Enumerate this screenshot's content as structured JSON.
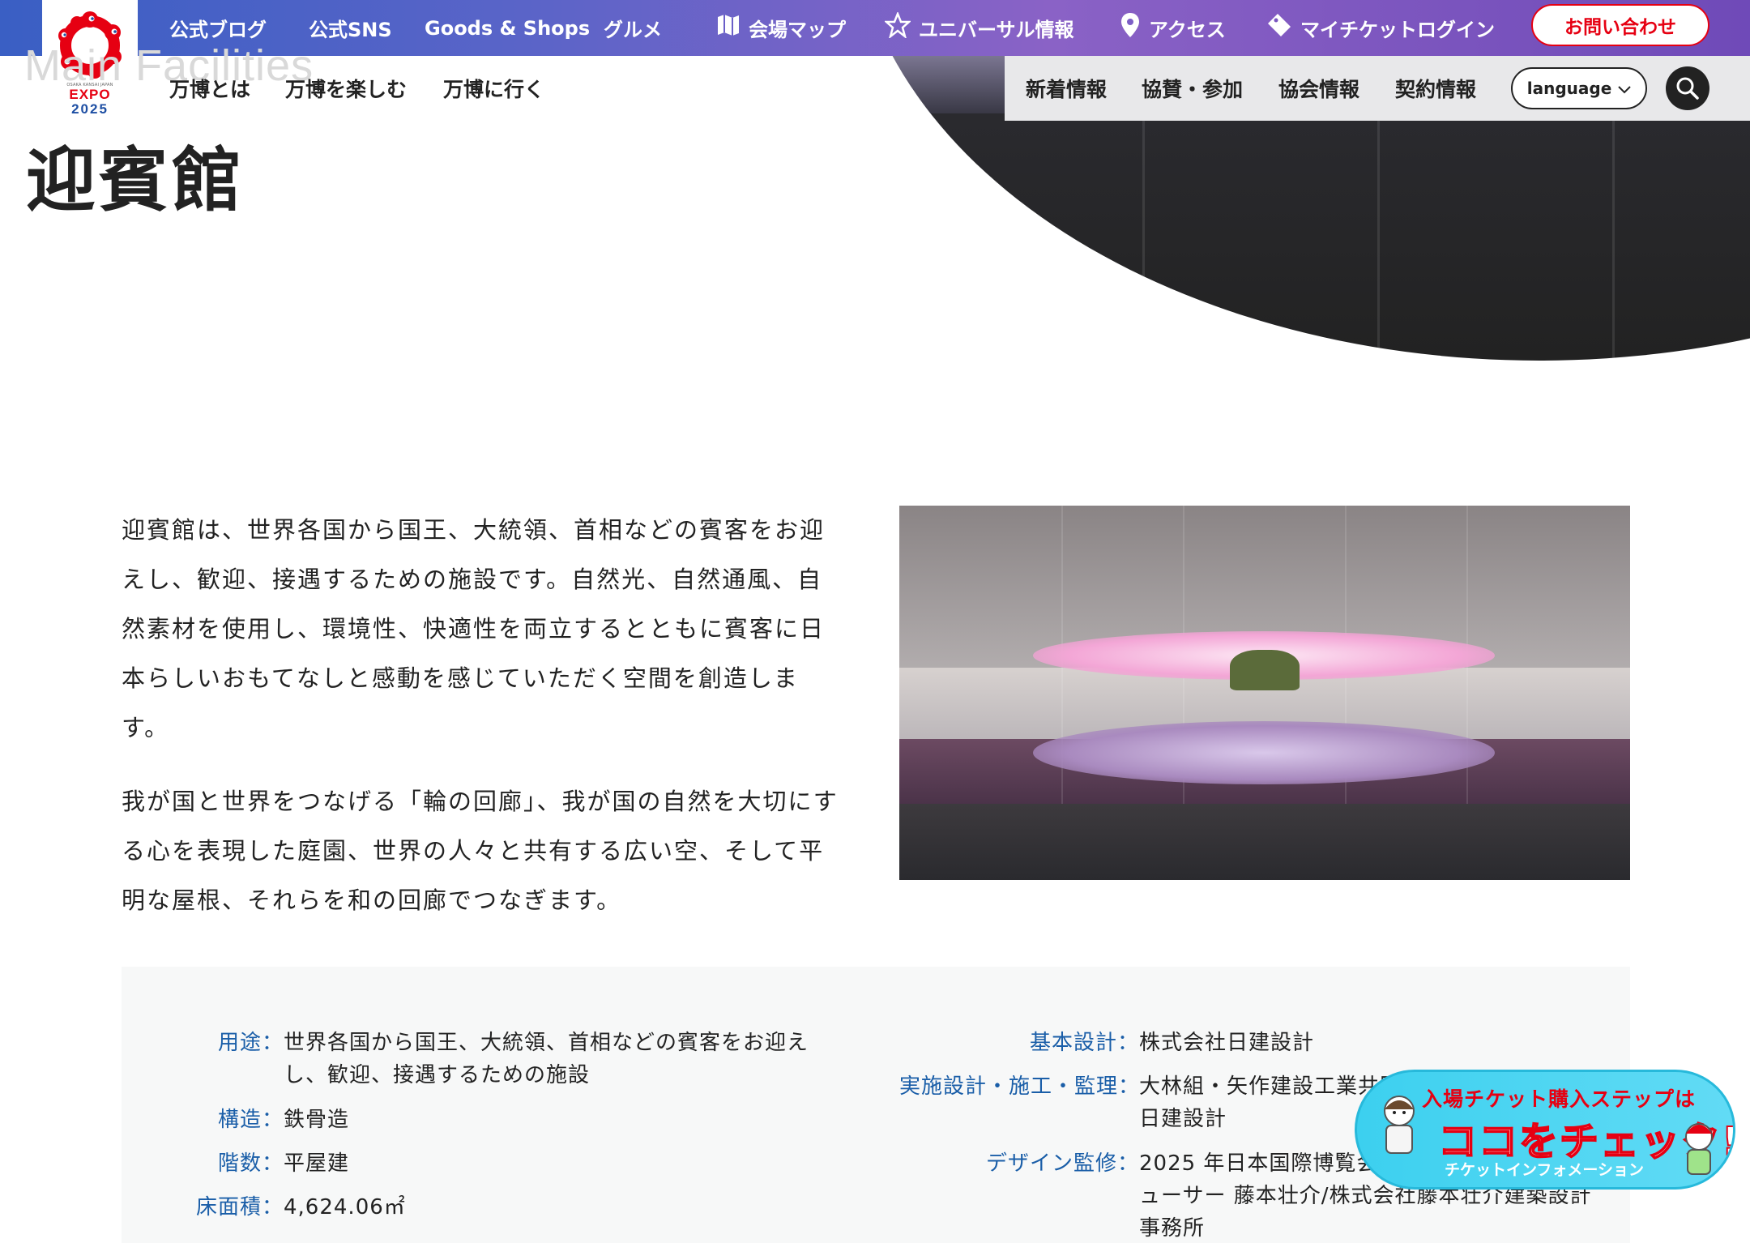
{
  "logo": {
    "tagline": "OSAKA KANSAI JAPAN",
    "name": "EXPO",
    "year": "2025"
  },
  "top_nav": {
    "items": [
      {
        "label": "公式ブログ"
      },
      {
        "label": "公式SNS"
      },
      {
        "label": "Goods & Shops"
      },
      {
        "label": "グルメ"
      },
      {
        "label": "会場マップ",
        "icon": "map-icon"
      },
      {
        "label": "ユニバーサル情報",
        "icon": "universal-icon"
      },
      {
        "label": "アクセス",
        "icon": "location-pin-icon"
      },
      {
        "label": "マイチケットログイン",
        "icon": "ticket-icon"
      }
    ],
    "contact": "お問い合わせ"
  },
  "sub_nav": {
    "left": [
      "万博とは",
      "万博を楽しむ",
      "万博に行く"
    ],
    "right": [
      "新着情報",
      "協賛・参加",
      "協会情報",
      "契約情報"
    ],
    "language": "language"
  },
  "header": {
    "bg_word": "Main Facilities",
    "title": "迎賓館"
  },
  "intro": {
    "p1": "迎賓館は、世界各国から国王、大統領、首相などの賓客をお迎えし、歓迎、接遇するための施設です。自然光、自然通風、自然素材を使用し、環境性、快適性を両立するとともに賓客に日本らしいおもてなしと感動を感じていただく空間を創造します。",
    "p2": "我が国と世界をつなげる「輪の回廊」、我が国の自然を大切にする心を表現した庭園、世界の人々と共有する広い空、そして平明な屋根、それらを和の回廊でつなぎます。"
  },
  "spec": {
    "left": [
      {
        "key": "用途：",
        "val": "世界各国から国王、大統領、首相などの賓客をお迎えし、歓迎、接遇するための施設"
      },
      {
        "key": "構造：",
        "val": "鉄骨造"
      },
      {
        "key": "階数：",
        "val": "平屋建"
      },
      {
        "key": "床面積：",
        "val": "4,624.06㎡"
      }
    ],
    "right": [
      {
        "key": "基本設計：",
        "val": "株式会社日建設計"
      },
      {
        "key": "実施設計・施工・監理：",
        "val": "大林組・矢作建設工業共同企業体／株式会社日建設計"
      },
      {
        "key": "デザイン監修：",
        "val": "2025 年日本国際博覧会 会場デザインプロデューサー 藤本壮介/株式会社藤本壮介建築設計事務所"
      }
    ]
  },
  "banner": {
    "line1": "入場チケット購入ステップは",
    "line2": "ココをチェック!!",
    "line3": "チケットインフォメーション"
  },
  "colors": {
    "accent": "#e60012",
    "link": "#1a5ea8",
    "brand_blue": "#1d4ea3"
  }
}
